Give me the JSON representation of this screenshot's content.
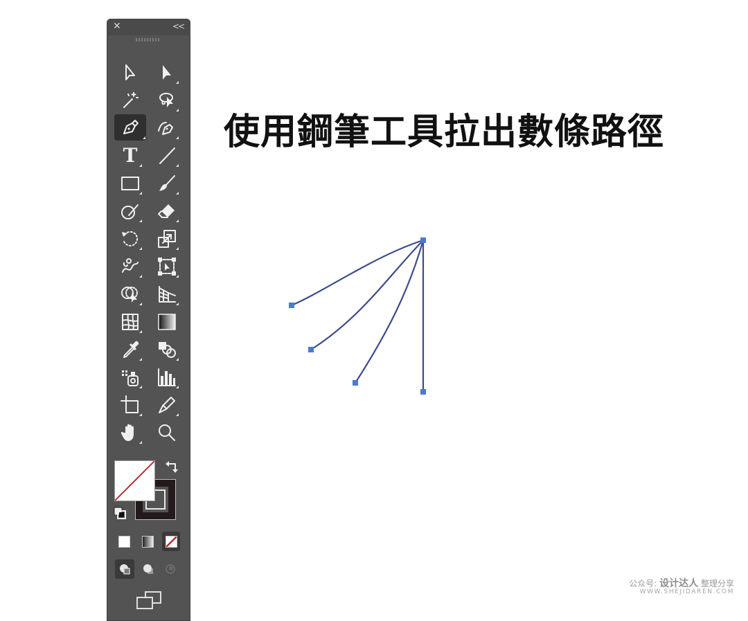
{
  "panel": {
    "close_glyph": "✕",
    "collapse_glyph": "<<",
    "tools": [
      {
        "name": "selection-tool",
        "icon": "arrow-outline-icon"
      },
      {
        "name": "direct-selection-tool",
        "icon": "arrow-filled-icon"
      },
      {
        "name": "magic-wand-tool",
        "icon": "magic-wand-icon"
      },
      {
        "name": "lasso-tool",
        "icon": "lasso-icon"
      },
      {
        "name": "pen-tool",
        "icon": "pen-icon",
        "active": true
      },
      {
        "name": "curvature-tool",
        "icon": "curvature-pen-icon"
      },
      {
        "name": "type-tool",
        "icon": "type-icon",
        "glyph": "T"
      },
      {
        "name": "line-segment-tool",
        "icon": "line-icon"
      },
      {
        "name": "rectangle-tool",
        "icon": "rectangle-icon"
      },
      {
        "name": "paintbrush-tool",
        "icon": "paintbrush-icon"
      },
      {
        "name": "shaper-tool",
        "icon": "shaper-icon"
      },
      {
        "name": "eraser-tool",
        "icon": "eraser-icon"
      },
      {
        "name": "rotate-tool",
        "icon": "rotate-icon"
      },
      {
        "name": "scale-tool",
        "icon": "scale-icon"
      },
      {
        "name": "warp-tool",
        "icon": "warp-icon"
      },
      {
        "name": "free-transform-tool",
        "icon": "free-transform-icon"
      },
      {
        "name": "shape-builder-tool",
        "icon": "shape-builder-icon"
      },
      {
        "name": "perspective-grid-tool",
        "icon": "perspective-grid-icon"
      },
      {
        "name": "mesh-tool",
        "icon": "mesh-icon"
      },
      {
        "name": "gradient-tool",
        "icon": "gradient-icon"
      },
      {
        "name": "eyedropper-tool",
        "icon": "eyedropper-icon"
      },
      {
        "name": "blend-tool",
        "icon": "blend-icon"
      },
      {
        "name": "symbol-sprayer-tool",
        "icon": "symbol-sprayer-icon"
      },
      {
        "name": "column-graph-tool",
        "icon": "column-graph-icon"
      },
      {
        "name": "artboard-tool",
        "icon": "artboard-icon"
      },
      {
        "name": "slice-tool",
        "icon": "slice-icon"
      },
      {
        "name": "hand-tool",
        "icon": "hand-icon"
      },
      {
        "name": "zoom-tool",
        "icon": "zoom-icon"
      }
    ],
    "fill_color": "#ffffff",
    "stroke_color": "#231a1a",
    "none_slash_color": "#c1272d"
  },
  "canvas": {
    "heading": "使用鋼筆工具拉出數條路徑",
    "path_color": "#3b4a8c",
    "anchor_color": "#4a7ad0"
  },
  "watermark": {
    "prefix": "公众号:",
    "brand": "设计达人",
    "suffix": "整理分享",
    "url": "WWW.SHEJIDAREN.COM"
  }
}
